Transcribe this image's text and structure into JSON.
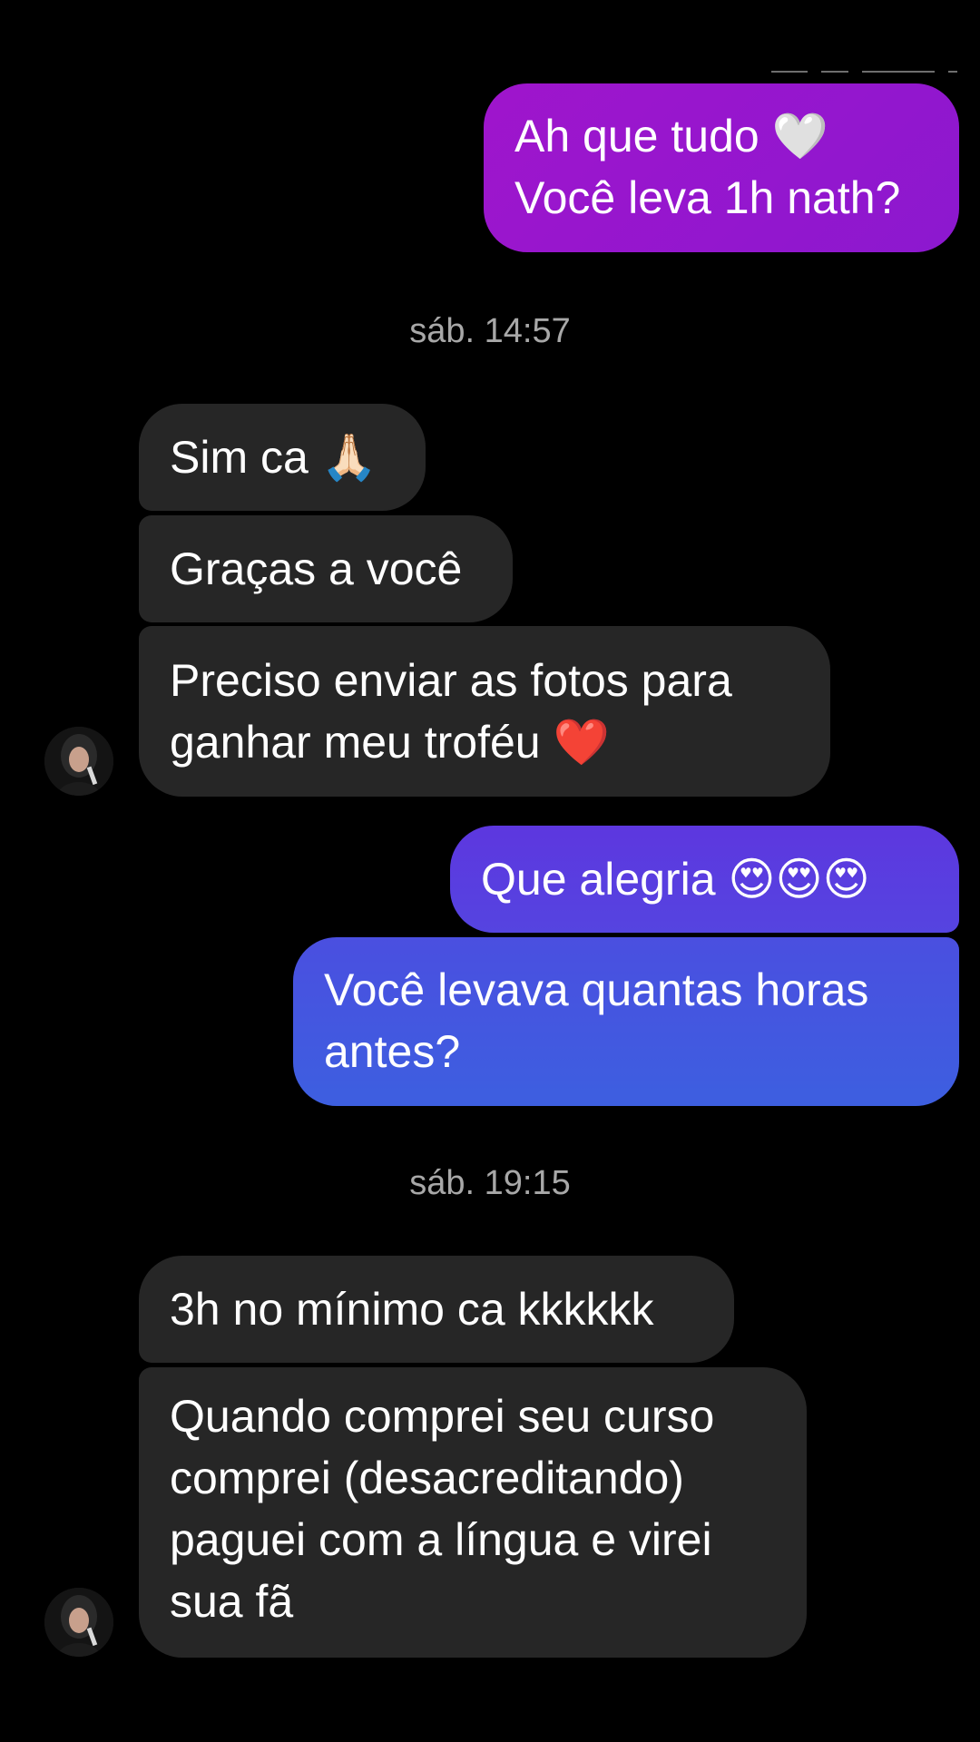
{
  "conversation": {
    "messages": [
      {
        "id": "m1",
        "side": "outgoing",
        "lines": [
          "Ah que tudo 🤍",
          "Você leva 1h nath?"
        ]
      },
      {
        "id": "t1",
        "side": "timestamp",
        "text": "sáb. 14:57"
      },
      {
        "id": "m2",
        "side": "incoming",
        "lines": [
          "Sim ca 🙏🏻"
        ]
      },
      {
        "id": "m3",
        "side": "incoming",
        "lines": [
          "Graças a você"
        ]
      },
      {
        "id": "m4",
        "side": "incoming",
        "lines": [
          "Preciso enviar as fotos para",
          "ganhar meu troféu ❤️"
        ]
      },
      {
        "id": "m5",
        "side": "outgoing",
        "lines": [
          "Que alegria 😍😍😍"
        ]
      },
      {
        "id": "m6",
        "side": "outgoing",
        "lines": [
          "Você levava quantas horas",
          "antes?"
        ]
      },
      {
        "id": "t2",
        "side": "timestamp",
        "text": "sáb. 19:15"
      },
      {
        "id": "m7",
        "side": "incoming",
        "lines": [
          "3h no mínimo ca kkkkkk"
        ]
      },
      {
        "id": "m8",
        "side": "incoming",
        "lines": [
          "Quando comprei seu curso",
          "comprei (desacreditando)",
          "paguei com a língua e virei",
          "sua fã"
        ]
      }
    ]
  },
  "icons": {
    "avatar": "contact-avatar"
  },
  "colors": {
    "background": "#000000",
    "incoming_bubble": "#262626",
    "outgoing_top": "#9c12c6",
    "outgoing_middle": "#5b3be0",
    "outgoing_bottom": "#3d5ee0",
    "timestamp_text": "#a8a8a8",
    "message_text": "#ffffff"
  }
}
